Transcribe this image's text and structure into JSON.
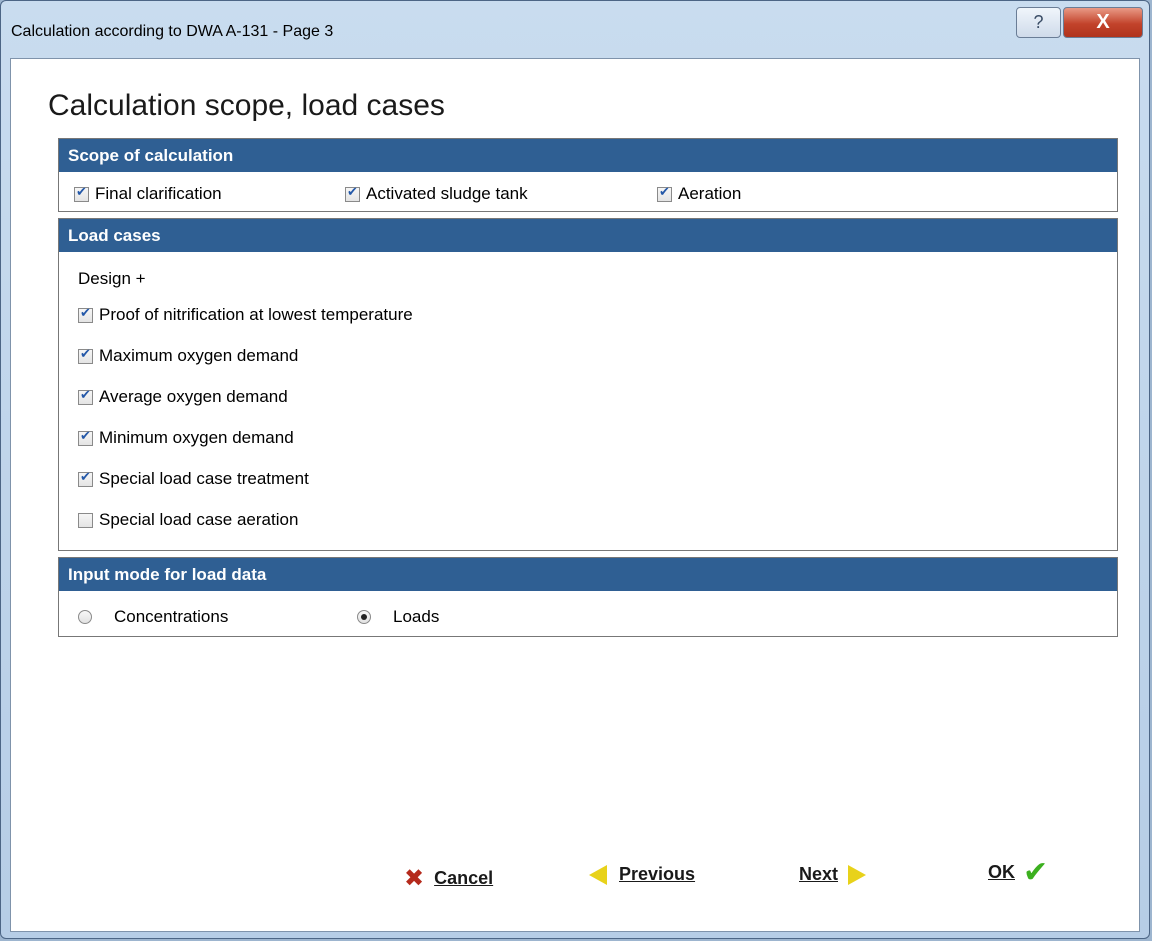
{
  "window": {
    "title": "Calculation according to DWA  A-131 - Page 3",
    "help_glyph": "?",
    "close_glyph": "X"
  },
  "page_title": "Calculation scope, load cases",
  "scope": {
    "header": "Scope of calculation",
    "items": [
      {
        "label": "Final clarification",
        "checked": true
      },
      {
        "label": "Activated sludge tank",
        "checked": true
      },
      {
        "label": "Aeration",
        "checked": true
      }
    ]
  },
  "load_cases": {
    "header": "Load cases",
    "design_label": "Design +",
    "items": [
      {
        "label": "Proof of nitrification at lowest temperature",
        "checked": true
      },
      {
        "label": "Maximum oxygen demand",
        "checked": true
      },
      {
        "label": "Average oxygen demand",
        "checked": true
      },
      {
        "label": "Minimum oxygen demand",
        "checked": true
      },
      {
        "label": "Special load case treatment",
        "checked": true
      },
      {
        "label": "Special load case aeration",
        "checked": false
      }
    ]
  },
  "input_mode": {
    "header": "Input mode for load data",
    "options": [
      {
        "label": "Concentrations",
        "selected": false
      },
      {
        "label": "Loads",
        "selected": true
      }
    ]
  },
  "footer": {
    "cancel": "Cancel",
    "previous": "Previous",
    "next": "Next",
    "ok": "OK"
  },
  "icons": {
    "cancel": "x-icon",
    "previous": "arrow-left-icon",
    "next": "arrow-right-icon",
    "ok": "checkmark-icon"
  },
  "colors": {
    "group_header": "#2f5f93",
    "close_button": "#c2432b",
    "arrow": "#e8d21a",
    "ok_check": "#3cb01f",
    "cancel_x": "#b52a1c"
  }
}
